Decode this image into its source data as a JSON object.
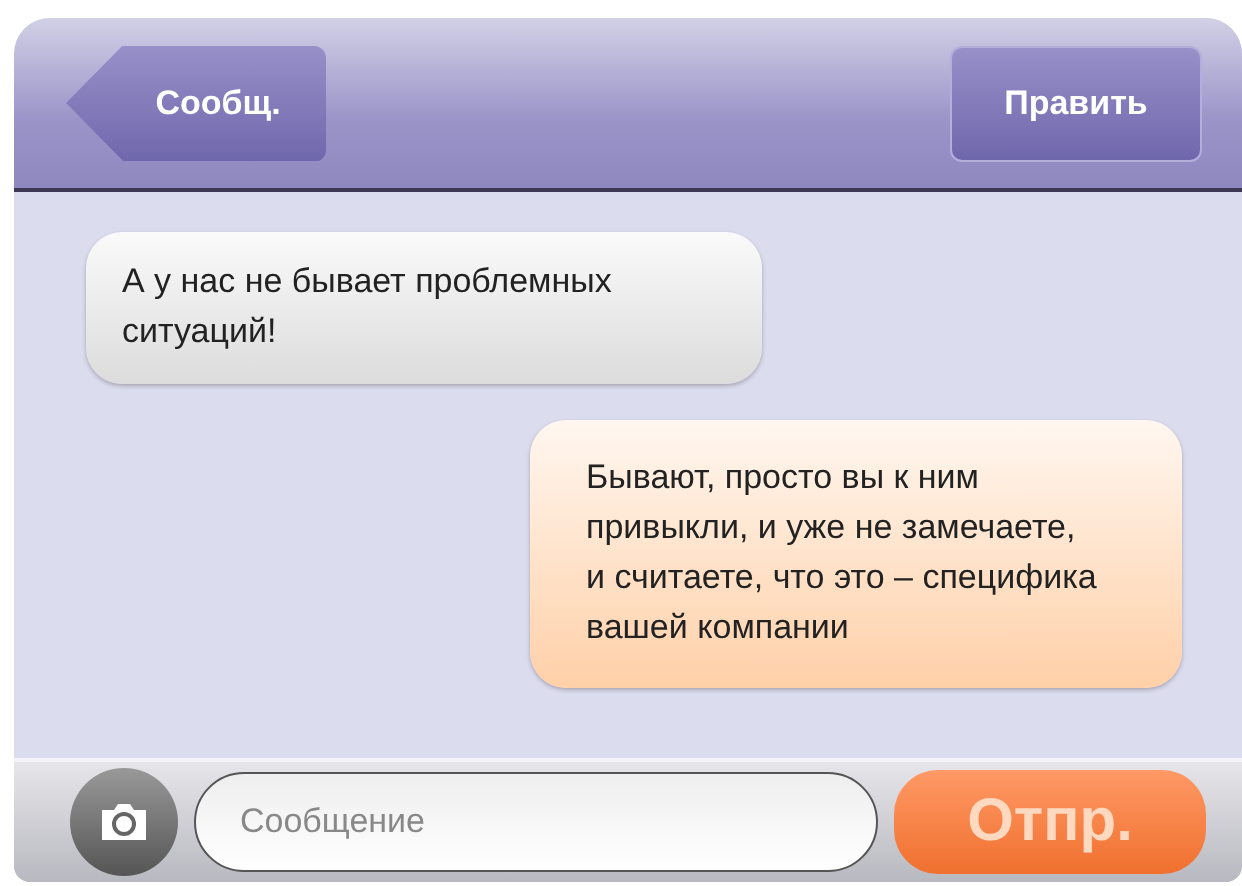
{
  "nav_bar": {
    "back_button": "Сообщ.",
    "edit_button": "Править"
  },
  "messages": [
    {
      "kind": "incoming",
      "text": "А у нас не бывает проблемных ситуаций!"
    },
    {
      "kind": "outgoing",
      "text": "Бывают, просто вы к ним привыкли, и уже не замечаете, и считаете, что это – специфика вашей компании"
    }
  ],
  "composer": {
    "placeholder": "Сообщение",
    "send_button": "Отпр."
  }
}
